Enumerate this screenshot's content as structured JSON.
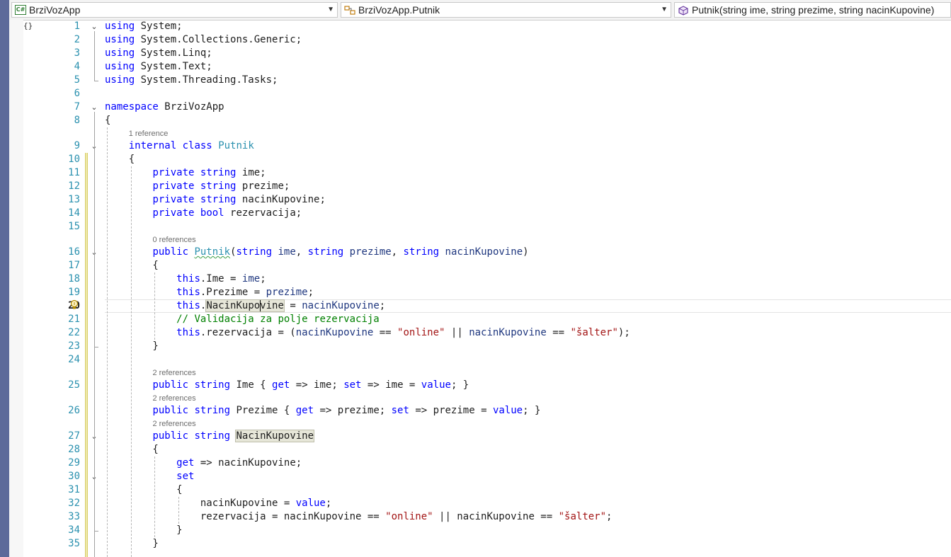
{
  "navbar": {
    "project": "BrziVozApp",
    "project_icon": "csharp-project-icon",
    "class": "BrziVozApp.Putnik",
    "class_icon": "class-icon",
    "member": "Putnik(string ime, string prezime, string nacinKupovine)",
    "member_icon": "method-icon"
  },
  "editor": {
    "current_line": 20,
    "collapse_glyph": "{}",
    "lines": [
      {
        "n": "1",
        "segments": [
          {
            "t": "using",
            "c": "kw"
          },
          {
            "t": " System;",
            "c": ""
          }
        ]
      },
      {
        "n": "2",
        "segments": [
          {
            "t": "using",
            "c": "kw"
          },
          {
            "t": " System.Collections.Generic;",
            "c": ""
          }
        ]
      },
      {
        "n": "3",
        "segments": [
          {
            "t": "using",
            "c": "kw"
          },
          {
            "t": " System.Linq;",
            "c": ""
          }
        ]
      },
      {
        "n": "4",
        "segments": [
          {
            "t": "using",
            "c": "kw"
          },
          {
            "t": " System.Text;",
            "c": ""
          }
        ]
      },
      {
        "n": "5",
        "segments": [
          {
            "t": "using",
            "c": "kw"
          },
          {
            "t": " System.Threading.Tasks;",
            "c": ""
          }
        ]
      },
      {
        "n": "6",
        "segments": []
      },
      {
        "n": "7",
        "segments": [
          {
            "t": "namespace",
            "c": "kw"
          },
          {
            "t": " BrziVozApp",
            "c": ""
          }
        ]
      },
      {
        "n": "8",
        "segments": [
          {
            "t": "{",
            "c": ""
          }
        ]
      },
      {
        "n": "9",
        "lens": "1 reference",
        "segments": [
          {
            "t": "    ",
            "c": ""
          },
          {
            "t": "internal",
            "c": "kw"
          },
          {
            "t": " ",
            "c": ""
          },
          {
            "t": "class",
            "c": "kw"
          },
          {
            "t": " ",
            "c": ""
          },
          {
            "t": "Putnik",
            "c": "ty"
          }
        ]
      },
      {
        "n": "10",
        "segments": [
          {
            "t": "    {",
            "c": ""
          }
        ]
      },
      {
        "n": "11",
        "segments": [
          {
            "t": "        ",
            "c": ""
          },
          {
            "t": "private",
            "c": "kw"
          },
          {
            "t": " ",
            "c": ""
          },
          {
            "t": "string",
            "c": "kw"
          },
          {
            "t": " ime;",
            "c": ""
          }
        ]
      },
      {
        "n": "12",
        "segments": [
          {
            "t": "        ",
            "c": ""
          },
          {
            "t": "private",
            "c": "kw"
          },
          {
            "t": " ",
            "c": ""
          },
          {
            "t": "string",
            "c": "kw"
          },
          {
            "t": " prezime;",
            "c": ""
          }
        ]
      },
      {
        "n": "13",
        "segments": [
          {
            "t": "        ",
            "c": ""
          },
          {
            "t": "private",
            "c": "kw"
          },
          {
            "t": " ",
            "c": ""
          },
          {
            "t": "string",
            "c": "kw"
          },
          {
            "t": " nacinKupovine;",
            "c": ""
          }
        ]
      },
      {
        "n": "14",
        "segments": [
          {
            "t": "        ",
            "c": ""
          },
          {
            "t": "private",
            "c": "kw"
          },
          {
            "t": " ",
            "c": ""
          },
          {
            "t": "bool",
            "c": "kw"
          },
          {
            "t": " rezervacija;",
            "c": ""
          }
        ]
      },
      {
        "n": "15",
        "segments": []
      },
      {
        "n": "16",
        "lens": "0 references",
        "segments": [
          {
            "t": "        ",
            "c": ""
          },
          {
            "t": "public",
            "c": "kw"
          },
          {
            "t": " ",
            "c": ""
          },
          {
            "t": "Putnik",
            "c": "ty squiggle"
          },
          {
            "t": "(",
            "c": ""
          },
          {
            "t": "string",
            "c": "kw"
          },
          {
            "t": " ",
            "c": ""
          },
          {
            "t": "ime",
            "c": "var"
          },
          {
            "t": ", ",
            "c": ""
          },
          {
            "t": "string",
            "c": "kw"
          },
          {
            "t": " ",
            "c": ""
          },
          {
            "t": "prezime",
            "c": "var"
          },
          {
            "t": ", ",
            "c": ""
          },
          {
            "t": "string",
            "c": "kw"
          },
          {
            "t": " ",
            "c": ""
          },
          {
            "t": "nacinKupovine",
            "c": "var"
          },
          {
            "t": ")",
            "c": ""
          }
        ]
      },
      {
        "n": "17",
        "segments": [
          {
            "t": "        {",
            "c": ""
          }
        ]
      },
      {
        "n": "18",
        "segments": [
          {
            "t": "            ",
            "c": ""
          },
          {
            "t": "this",
            "c": "kw"
          },
          {
            "t": ".Ime = ",
            "c": ""
          },
          {
            "t": "ime",
            "c": "var"
          },
          {
            "t": ";",
            "c": ""
          }
        ]
      },
      {
        "n": "19",
        "segments": [
          {
            "t": "            ",
            "c": ""
          },
          {
            "t": "this",
            "c": "kw"
          },
          {
            "t": ".Prezime = ",
            "c": ""
          },
          {
            "t": "prezime",
            "c": "var"
          },
          {
            "t": ";",
            "c": ""
          }
        ]
      },
      {
        "n": "20",
        "segments": [
          {
            "t": "            ",
            "c": ""
          },
          {
            "t": "this",
            "c": "kw"
          },
          {
            "t": ".",
            "c": ""
          },
          {
            "t": "NacinKupovine",
            "c": "hl"
          },
          {
            "t": " = ",
            "c": ""
          },
          {
            "t": "nacinKupovine",
            "c": "var"
          },
          {
            "t": ";",
            "c": ""
          }
        ]
      },
      {
        "n": "21",
        "segments": [
          {
            "t": "            ",
            "c": ""
          },
          {
            "t": "// Validacija za polje rezervacija",
            "c": "cm"
          }
        ]
      },
      {
        "n": "22",
        "segments": [
          {
            "t": "            ",
            "c": ""
          },
          {
            "t": "this",
            "c": "kw"
          },
          {
            "t": ".rezervacija = (",
            "c": ""
          },
          {
            "t": "nacinKupovine",
            "c": "var"
          },
          {
            "t": " == ",
            "c": ""
          },
          {
            "t": "\"online\"",
            "c": "str"
          },
          {
            "t": " || ",
            "c": ""
          },
          {
            "t": "nacinKupovine",
            "c": "var"
          },
          {
            "t": " == ",
            "c": ""
          },
          {
            "t": "\"šalter\"",
            "c": "str"
          },
          {
            "t": ");",
            "c": ""
          }
        ]
      },
      {
        "n": "23",
        "segments": [
          {
            "t": "        }",
            "c": ""
          }
        ]
      },
      {
        "n": "24",
        "segments": []
      },
      {
        "n": "25",
        "lens": "2 references",
        "segments": [
          {
            "t": "        ",
            "c": ""
          },
          {
            "t": "public",
            "c": "kw"
          },
          {
            "t": " ",
            "c": ""
          },
          {
            "t": "string",
            "c": "kw"
          },
          {
            "t": " Ime { ",
            "c": ""
          },
          {
            "t": "get",
            "c": "kw"
          },
          {
            "t": " => ime; ",
            "c": ""
          },
          {
            "t": "set",
            "c": "kw"
          },
          {
            "t": " => ime = ",
            "c": ""
          },
          {
            "t": "value",
            "c": "kw"
          },
          {
            "t": "; }",
            "c": ""
          }
        ]
      },
      {
        "n": "26",
        "lens": "2 references",
        "segments": [
          {
            "t": "        ",
            "c": ""
          },
          {
            "t": "public",
            "c": "kw"
          },
          {
            "t": " ",
            "c": ""
          },
          {
            "t": "string",
            "c": "kw"
          },
          {
            "t": " Prezime { ",
            "c": ""
          },
          {
            "t": "get",
            "c": "kw"
          },
          {
            "t": " => prezime; ",
            "c": ""
          },
          {
            "t": "set",
            "c": "kw"
          },
          {
            "t": " => prezime = ",
            "c": ""
          },
          {
            "t": "value",
            "c": "kw"
          },
          {
            "t": "; }",
            "c": ""
          }
        ]
      },
      {
        "n": "27",
        "lens": "2 references",
        "segments": [
          {
            "t": "        ",
            "c": ""
          },
          {
            "t": "public",
            "c": "kw"
          },
          {
            "t": " ",
            "c": ""
          },
          {
            "t": "string",
            "c": "kw"
          },
          {
            "t": " ",
            "c": ""
          },
          {
            "t": "NacinKupovine",
            "c": "hl"
          }
        ]
      },
      {
        "n": "28",
        "segments": [
          {
            "t": "        {",
            "c": ""
          }
        ]
      },
      {
        "n": "29",
        "segments": [
          {
            "t": "            ",
            "c": ""
          },
          {
            "t": "get",
            "c": "kw"
          },
          {
            "t": " => nacinKupovine;",
            "c": ""
          }
        ]
      },
      {
        "n": "30",
        "segments": [
          {
            "t": "            ",
            "c": ""
          },
          {
            "t": "set",
            "c": "kw"
          }
        ]
      },
      {
        "n": "31",
        "segments": [
          {
            "t": "            {",
            "c": ""
          }
        ]
      },
      {
        "n": "32",
        "segments": [
          {
            "t": "                nacinKupovine = ",
            "c": ""
          },
          {
            "t": "value",
            "c": "kw"
          },
          {
            "t": ";",
            "c": ""
          }
        ]
      },
      {
        "n": "33",
        "segments": [
          {
            "t": "                rezervacija = nacinKupovine == ",
            "c": ""
          },
          {
            "t": "\"online\"",
            "c": "str"
          },
          {
            "t": " || nacinKupovine == ",
            "c": ""
          },
          {
            "t": "\"šalter\"",
            "c": "str"
          },
          {
            "t": ";",
            "c": ""
          }
        ]
      },
      {
        "n": "34",
        "segments": [
          {
            "t": "            }",
            "c": ""
          }
        ]
      },
      {
        "n": "35",
        "segments": [
          {
            "t": "        }",
            "c": ""
          }
        ]
      }
    ]
  }
}
